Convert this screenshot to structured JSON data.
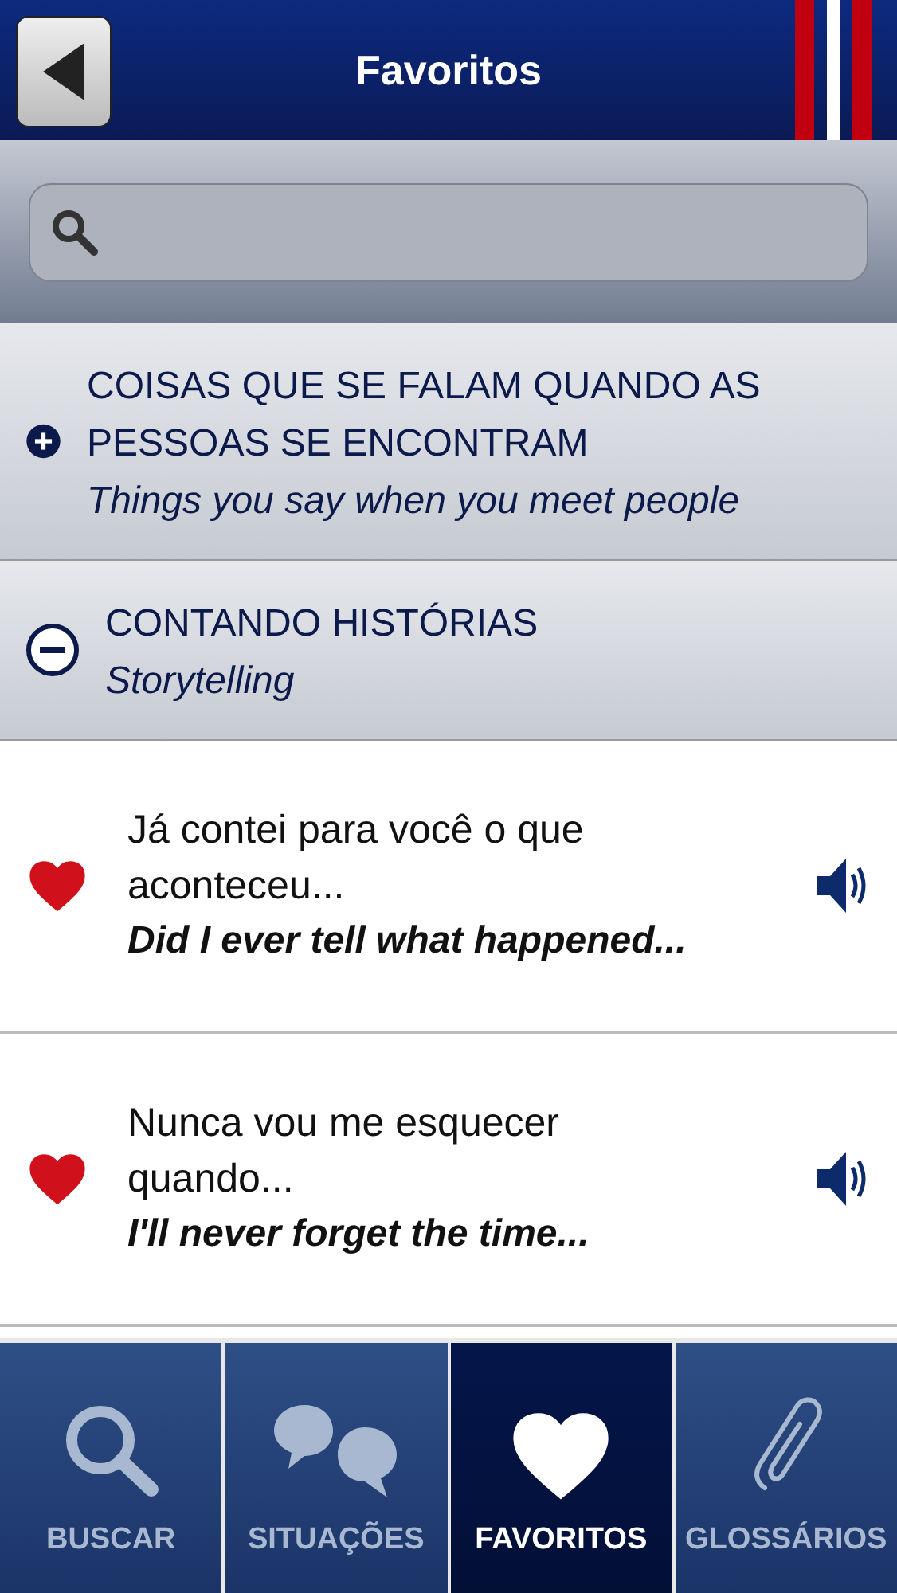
{
  "header": {
    "title": "Favoritos"
  },
  "categories": [
    {
      "title": "COISAS QUE SE FALAM QUANDO AS PESSOAS SE ENCONTRAM",
      "subtitle": "Things you say when you meet people",
      "expanded": false
    },
    {
      "title": "CONTANDO HISTÓRIAS",
      "subtitle": "Storytelling",
      "expanded": true
    }
  ],
  "phrases": [
    {
      "text": "Já contei para você o que aconteceu...",
      "translation": "Did I ever tell what happened...",
      "favorite": true
    },
    {
      "text": "Nunca vou me esquecer quando...",
      "translation": "I'll never forget the time...",
      "favorite": true
    }
  ],
  "tabs": [
    {
      "kind": "search",
      "label": "BUSCAR",
      "selected": false
    },
    {
      "kind": "chat",
      "label": "SITUAÇÕES",
      "selected": false
    },
    {
      "kind": "heart",
      "label": "FAVORITOS",
      "selected": true
    },
    {
      "kind": "clip",
      "label": "GLOSSÁRIOS",
      "selected": false
    }
  ]
}
